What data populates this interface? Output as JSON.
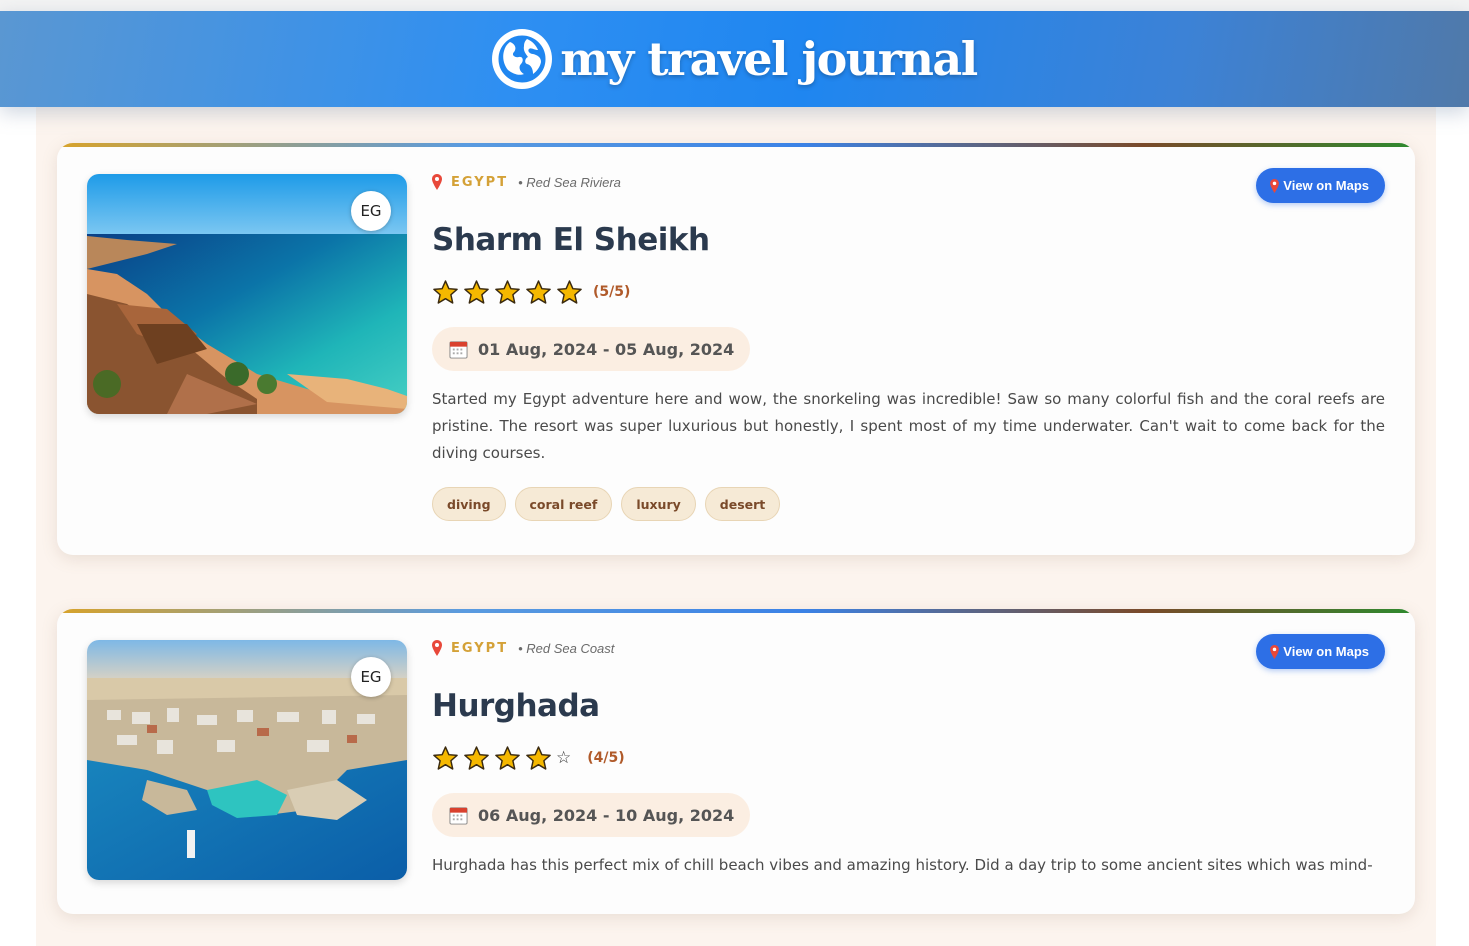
{
  "header": {
    "title": "my travel journal",
    "icon": "globe-icon"
  },
  "entries": [
    {
      "country_code": "EG",
      "country": "EGYPT",
      "region": "• Red Sea Riviera",
      "maps_label": "View on Maps",
      "title": "Sharm El Sheikh",
      "rating": 5,
      "rating_text": "(5/5)",
      "dates": "01 Aug, 2024 - 05 Aug, 2024",
      "description": "Started my Egypt adventure here and wow, the snorkeling was incredible! Saw so many colorful fish and the coral reefs are pristine. The resort was super luxurious but honestly, I spent most of my time underwater. Can't wait to come back for the diving courses.",
      "tags": [
        "diving",
        "coral reef",
        "luxury",
        "desert"
      ]
    },
    {
      "country_code": "EG",
      "country": "EGYPT",
      "region": "• Red Sea Coast",
      "maps_label": "View on Maps",
      "title": "Hurghada",
      "rating": 4,
      "rating_text": "(4/5)",
      "dates": "06 Aug, 2024 - 10 Aug, 2024",
      "description": "Hurghada has this perfect mix of chill beach vibes and amazing history. Did a day trip to some ancient sites which was mind-"
    }
  ],
  "colors": {
    "header_blue": "#1f86f0",
    "country_gold": "#d4a137",
    "title_navy": "#2b3a4e",
    "maps_button": "#2d6fe6",
    "tag_bg": "#f6ead6",
    "tag_text": "#7a4a2a",
    "star": "#f5b800"
  }
}
